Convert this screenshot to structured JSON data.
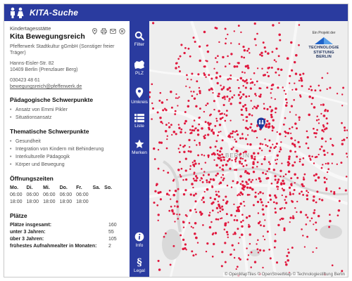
{
  "app": {
    "title": "KITA-Suche",
    "brand_color": "#2a3b9f"
  },
  "detail": {
    "type": "Kindertagesstätte",
    "name": "Kita Bewegungsreich",
    "provider": "Pfefferwerk Stadtkultur gGmbH (Sonstiger freier Träger)",
    "street": "Hanns-Eisler-Str. 82",
    "city": "10409 Berlin (Prenzlauer Berg)",
    "phone": "030423 48 61",
    "email": "bewegungsreich@pfefferwerk.de",
    "tool_icons": [
      "location-icon",
      "print-icon",
      "share-icon",
      "close-icon"
    ],
    "paed_heading": "Pädagogische Schwerpunkte",
    "paed_items": [
      "Ansatz von Emmi Pikler",
      "Situationsansatz"
    ],
    "them_heading": "Thematische Schwerpunkte",
    "them_items": [
      "Gesundheit",
      "Integration von Kindern mit Behinderung",
      "Interkulturelle Pädagogik",
      "Körper und Bewegung"
    ],
    "hours_heading": "Öffnungszeiten",
    "hours": {
      "days": [
        "Mo.",
        "Di.",
        "Mi.",
        "Do.",
        "Fr.",
        "Sa.",
        "So."
      ],
      "open": [
        "06:00",
        "06:00",
        "06:00",
        "06:00",
        "06:00",
        "",
        ""
      ],
      "close": [
        "18:00",
        "18:00",
        "18:00",
        "18:00",
        "18:00",
        "",
        ""
      ]
    },
    "places_heading": "Plätze",
    "places": [
      {
        "label": "Plätze insgesamt:",
        "value": "160"
      },
      {
        "label": "unter 3 Jahren:",
        "value": "55"
      },
      {
        "label": "über 3 Jahren:",
        "value": "105"
      },
      {
        "label": "frühestes Aufnahmealter in Monaten:",
        "value": "2"
      }
    ]
  },
  "nav": {
    "filter": "Filter",
    "plz": "PLZ",
    "umkreis": "Umkreis",
    "liste": "Liste",
    "merken": "Merken",
    "info": "Info",
    "legal": "Legal"
  },
  "map": {
    "city_label": "BERLIN",
    "attribution": "© OpenMapTiles © OpenStreetMap © Technologiestiftung Berlin",
    "partner_small": "Ein Projekt der",
    "partner_line1": "TECHNOLOGIE",
    "partner_line2": "STIFTUNG",
    "partner_line3": "BERLIN",
    "marker_color": "#e0193e",
    "pin_color": "#1f3a9c",
    "map_background": "#eeeeee"
  }
}
